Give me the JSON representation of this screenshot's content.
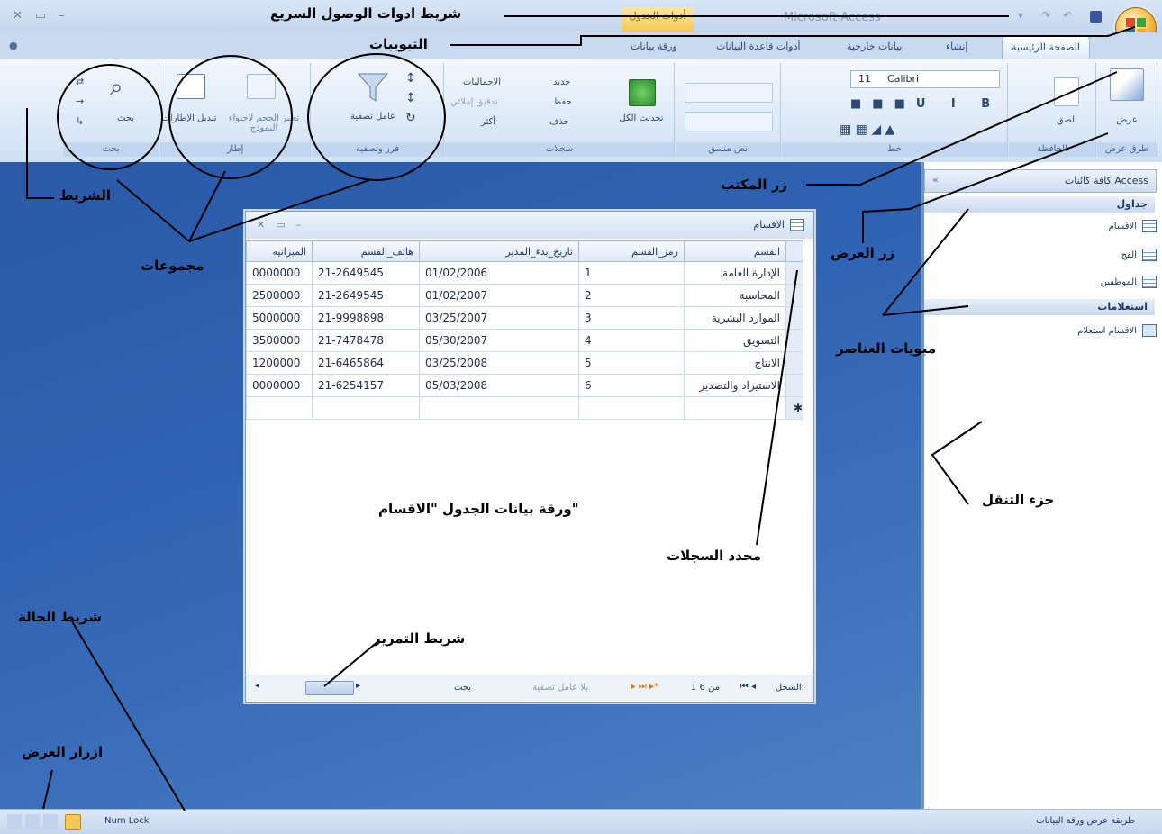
{
  "app": {
    "title": "Microsoft Access",
    "context_tab": "أدوات الجدول"
  },
  "tabs": [
    "الصفحة الرئيسية",
    "إنشاء",
    "بيانات خارجية",
    "أدوات قاعدة البيانات",
    "ورقة بيانات"
  ],
  "ribbon": {
    "groups": [
      "طرق عرض",
      "الحافظة",
      "خط",
      "نص منسق",
      "سجلات",
      "فرز وتصفية",
      "إطار",
      "بحث"
    ],
    "view_label": "عرض",
    "paste_label": "لصق",
    "font_name": "Calibri",
    "font_size": "11",
    "refresh_label": "تحديث الكل",
    "records_new": "جديد",
    "records_save": "حفظ",
    "records_delete": "حذف",
    "records_totals": "الاجماليات",
    "records_spelling": "تدقيق إملائي",
    "records_more": "أكثر",
    "filter_label": "عامل تصفية",
    "window_resize": "تغيير الحجم لاحتواء النموذج",
    "window_switch": "تبديل الإطارات",
    "find_label": "بحث"
  },
  "navpane": {
    "header": "كافة كائنات Access",
    "cat_tables": "جداول",
    "tables": [
      "الاقسام",
      "الفح",
      "الموظفين"
    ],
    "cat_queries": "استعلامات",
    "queries": [
      "الاقسام استعلام"
    ]
  },
  "datasheet": {
    "title": "الاقسام",
    "columns": [
      "القسم",
      "رمز_القسم",
      "تاريخ_بدء_المدير",
      "هاتف_القسم",
      "الميزانيه"
    ],
    "rows": [
      [
        "الإدارة العامة",
        "1",
        "01/02/2006",
        "21-2649545",
        "0000000"
      ],
      [
        "المحاسبة",
        "2",
        "01/02/2007",
        "21-2649545",
        "2500000"
      ],
      [
        "الموارد البشرية",
        "3",
        "03/25/2007",
        "21-9998898",
        "5000000"
      ],
      [
        "التسويق",
        "4",
        "05/30/2007",
        "21-7478478",
        "3500000"
      ],
      [
        "الانتاج",
        "5",
        "03/25/2008",
        "21-6465864",
        "1200000"
      ],
      [
        "الاستيراد والتصدير",
        "6",
        "05/03/2008",
        "21-6254157",
        "0000000"
      ]
    ],
    "nav_record_label": "السجل:",
    "nav_position": "1 من 6",
    "nav_filter": "بلا عامل تصفية",
    "nav_search": "بحث"
  },
  "statusbar": {
    "numlock": "Num Lock",
    "view_mode": "طريقة عرض ورقة البيانات"
  },
  "annotations": {
    "qat": "شريط ادوات الوصول السريع",
    "tabs": "التبويبات",
    "ribbon": "الشريط",
    "groups": "مجموعات",
    "office_button": "زر المكتب",
    "view_button": "زر العرض",
    "items_tabs": "مبويات العناصر",
    "nav_pane": "جزء التنقل",
    "datasheet": "ورقة بيانات الجدول \"الاقسام\"",
    "record_selector": "محدد السجلات",
    "scrollbar": "شريط التمرير",
    "status_bar": "شريط الحالة",
    "view_buttons": "ازرار العرض"
  }
}
